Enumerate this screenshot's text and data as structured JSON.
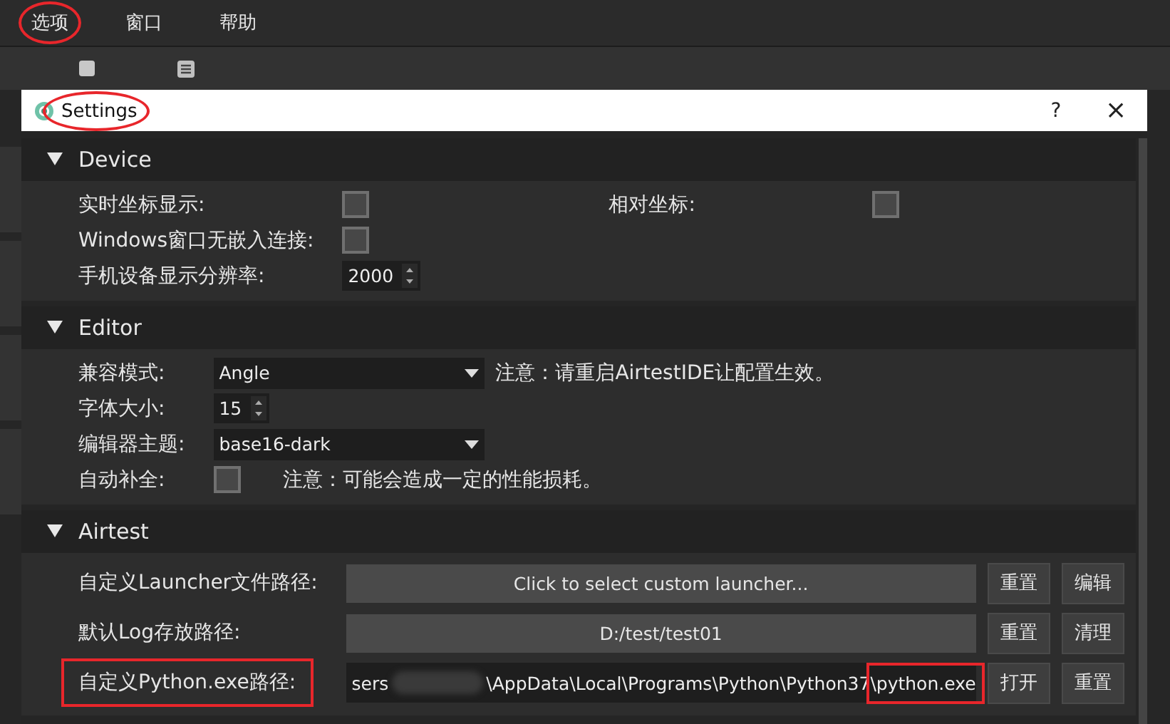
{
  "menu": [
    {
      "label": "选项",
      "highlighted": true
    },
    {
      "label": "窗口",
      "highlighted": false
    },
    {
      "label": "帮助",
      "highlighted": false
    }
  ],
  "dialog": {
    "title": "Settings",
    "title_highlighted": true,
    "help": "?",
    "close": "×",
    "sections": [
      {
        "title": "Device",
        "expanded": true,
        "rows": [
          {
            "items": [
              {
                "kind": "label",
                "text": "实时坐标显示:",
                "highlighted": false
              },
              {
                "kind": "checkbox",
                "checked": false
              },
              {
                "kind": "label",
                "text": "相对坐标:",
                "highlighted": false
              },
              {
                "kind": "checkbox",
                "checked": false
              }
            ]
          },
          {
            "items": [
              {
                "kind": "label",
                "text": "Windows窗口无嵌入连接:",
                "highlighted": false
              },
              {
                "kind": "checkbox",
                "checked": false
              }
            ]
          },
          {
            "items": [
              {
                "kind": "label",
                "text": "手机设备显示分辨率:",
                "highlighted": false
              },
              {
                "kind": "spin",
                "value": "2000"
              }
            ]
          }
        ]
      },
      {
        "title": "Editor",
        "expanded": true,
        "rows": [
          {
            "items": [
              {
                "kind": "label",
                "text": "兼容模式:",
                "highlighted": false
              },
              {
                "kind": "combo",
                "value": "Angle"
              },
              {
                "kind": "note",
                "text": "注意：请重启AirtestIDE让配置生效。"
              }
            ]
          },
          {
            "items": [
              {
                "kind": "label",
                "text": "字体大小:",
                "highlighted": false
              },
              {
                "kind": "spin",
                "value": "15"
              }
            ]
          },
          {
            "items": [
              {
                "kind": "label",
                "text": "编辑器主题:",
                "highlighted": false
              },
              {
                "kind": "combo",
                "value": "base16-dark"
              }
            ]
          },
          {
            "items": [
              {
                "kind": "label",
                "text": "自动补全:",
                "highlighted": false
              },
              {
                "kind": "checkbox",
                "checked": false
              },
              {
                "kind": "note",
                "text": "注意：可能会造成一定的性能损耗。"
              }
            ]
          }
        ]
      },
      {
        "title": "Airtest",
        "expanded": true,
        "rows": [
          {
            "items": [
              {
                "kind": "label",
                "text": "自定义Launcher文件路径:",
                "highlighted": false
              },
              {
                "kind": "path-button",
                "text": "Click to select custom launcher..."
              },
              {
                "kind": "button",
                "text": "重置"
              },
              {
                "kind": "button",
                "text": "编辑"
              }
            ]
          },
          {
            "items": [
              {
                "kind": "label",
                "text": "默认Log存放路径:",
                "highlighted": false
              },
              {
                "kind": "path-button",
                "text": "D:/test/test01"
              },
              {
                "kind": "button",
                "text": "重置"
              },
              {
                "kind": "button",
                "text": "清理"
              }
            ]
          },
          {
            "items": [
              {
                "kind": "label",
                "text": "自定义Python.exe路径:",
                "highlighted": true
              },
              {
                "kind": "path-field",
                "start": "sers",
                "middle": "\\AppData\\Local\\Programs\\Python\\Python37",
                "end": "\\python.exe",
                "end_highlighted": true
              },
              {
                "kind": "button",
                "text": "打开"
              },
              {
                "kind": "button",
                "text": "重置"
              }
            ]
          }
        ]
      }
    ]
  }
}
